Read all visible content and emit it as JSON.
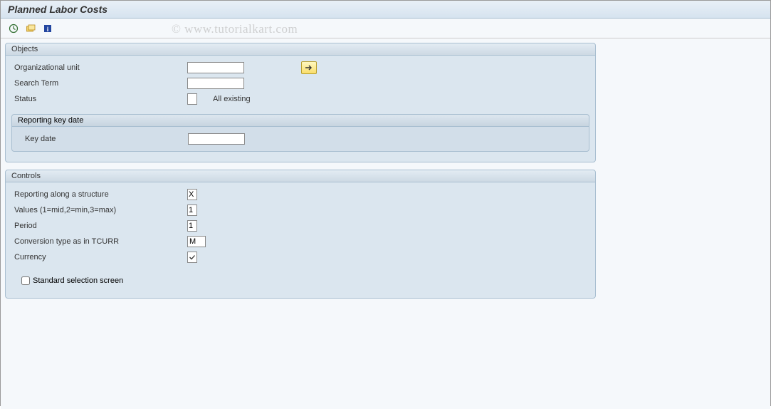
{
  "title": "Planned Labor Costs",
  "watermark": "© www.tutorialkart.com",
  "toolbar": {
    "execute_tip": "Execute",
    "variants_tip": "Get Variant",
    "info_tip": "Information"
  },
  "objects": {
    "title": "Objects",
    "org_unit_label": "Organizational unit",
    "org_unit_value": "",
    "search_term_label": "Search Term",
    "search_term_value": "",
    "status_label": "Status",
    "status_value": "",
    "status_text": "All existing",
    "reporting_key_date": {
      "title": "Reporting key date",
      "key_date_label": "Key date",
      "key_date_value": ""
    }
  },
  "controls": {
    "title": "Controls",
    "rep_structure_label": "Reporting along a structure",
    "rep_structure_value": "X",
    "values_label": "Values (1=mid,2=min,3=max)",
    "values_value": "1",
    "period_label": "Period",
    "period_value": "1",
    "conv_type_label": "Conversion type as in TCURR",
    "conv_type_value": "M",
    "currency_label": "Currency",
    "currency_checked": true,
    "std_sel_label": "Standard selection screen",
    "std_sel_checked": false
  }
}
